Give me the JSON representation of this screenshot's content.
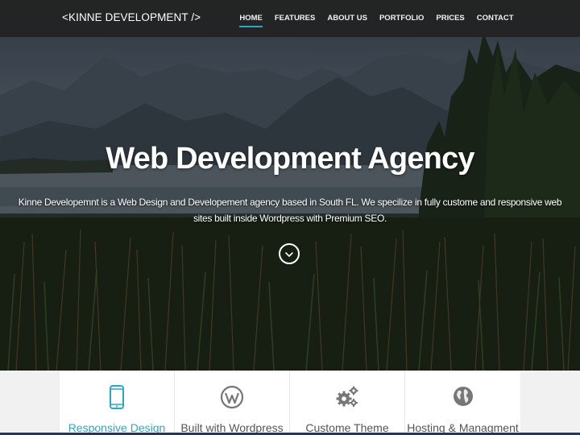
{
  "navbar": {
    "brand": "<KINNE DEVELOPMENT />",
    "items": [
      {
        "label": "HOME",
        "active": true
      },
      {
        "label": "FEATURES",
        "active": false
      },
      {
        "label": "ABOUT US",
        "active": false
      },
      {
        "label": "PORTFOLIO",
        "active": false
      },
      {
        "label": "PRICES",
        "active": false
      },
      {
        "label": "CONTACT",
        "active": false
      }
    ]
  },
  "hero": {
    "title": "Web Development Agency",
    "description": "Kinne Developemnt is a Web Design and Developement agency based in South FL. We specilize in fully custome and responsive web sites built inside Wordpress with Premium SEO.",
    "scroll_icon": "chevron-down-icon"
  },
  "features": [
    {
      "label": "Responsive Design",
      "icon": "mobile-phone-icon",
      "active": true
    },
    {
      "label": "Built with Wordpress",
      "icon": "wordpress-icon",
      "active": false
    },
    {
      "label": "Custome Theme",
      "icon": "gears-icon",
      "active": false
    },
    {
      "label": "Hosting & Managment",
      "icon": "globe-icon",
      "active": false
    }
  ],
  "colors": {
    "accent": "#29a9c6",
    "navbar_bg": "#222222",
    "feature_text": "#555555",
    "feature_icon": "#777777"
  }
}
